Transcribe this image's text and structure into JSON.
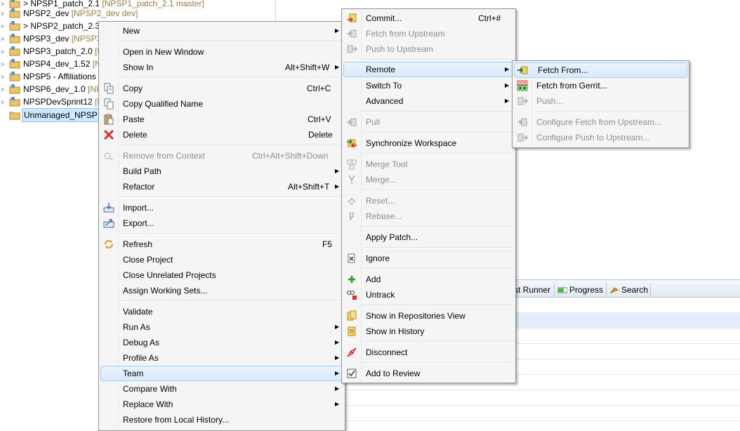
{
  "explorer": {
    "projects": [
      {
        "name": "> NPSP1_patch_2.1",
        "decoration": "[NPSP1_patch_2.1 master]",
        "twisty": "▹"
      },
      {
        "name": "NPSP2_dev",
        "decoration": "[NPSP2_dev dev]",
        "twisty": "▹"
      },
      {
        "name": "> NPSP2_patch_2.3",
        "decoration": "",
        "twisty": "▹"
      },
      {
        "name": "NPSP3_dev",
        "decoration": "[NPSP3_",
        "twisty": "▹"
      },
      {
        "name": "NPSP3_patch_2.0",
        "decoration": "[N",
        "twisty": "▹"
      },
      {
        "name": "NPSP4_dev_1.52",
        "decoration": "[NP",
        "twisty": "▹"
      },
      {
        "name": "NPSP5 - Affiliations",
        "decoration": "",
        "twisty": "▹"
      },
      {
        "name": "NPSP6_dev_1.0",
        "decoration": "[NPS",
        "twisty": "▹"
      },
      {
        "name": "NPSPDevSprint12",
        "decoration": "[N",
        "twisty": "▹"
      },
      {
        "name": "Unmanaged_NPSP [",
        "decoration": "",
        "twisty": ""
      }
    ]
  },
  "views": {
    "tabs": [
      {
        "label": "st Runner",
        "icon": "junit-icon"
      },
      {
        "label": "Progress",
        "icon": "progress-icon"
      },
      {
        "label": "Search",
        "icon": "search-icon"
      }
    ]
  },
  "context_menu": {
    "new": "New",
    "open_new_window": "Open in New Window",
    "show_in": "Show In",
    "show_in_accel": "Alt+Shift+W",
    "copy": "Copy",
    "copy_accel": "Ctrl+C",
    "copy_qualified": "Copy Qualified Name",
    "paste": "Paste",
    "paste_accel": "Ctrl+V",
    "delete": "Delete",
    "delete_accel": "Delete",
    "remove_context": "Remove from Context",
    "remove_context_accel": "Ctrl+Alt+Shift+Down",
    "build_path": "Build Path",
    "refactor": "Refactor",
    "refactor_accel": "Alt+Shift+T",
    "import": "Import...",
    "export": "Export...",
    "refresh": "Refresh",
    "refresh_accel": "F5",
    "close_project": "Close Project",
    "close_unrelated": "Close Unrelated Projects",
    "assign_sets": "Assign Working Sets...",
    "validate": "Validate",
    "run_as": "Run As",
    "debug_as": "Debug As",
    "profile_as": "Profile As",
    "team": "Team",
    "compare_with": "Compare With",
    "replace_with": "Replace With",
    "restore_history": "Restore from Local History..."
  },
  "team_menu": {
    "commit": "Commit...",
    "commit_accel": "Ctrl+#",
    "fetch_upstream": "Fetch from Upstream",
    "push_upstream": "Push to Upstream",
    "remote": "Remote",
    "switch_to": "Switch To",
    "advanced": "Advanced",
    "pull": "Pull",
    "synchronize": "Synchronize Workspace",
    "merge_tool": "Merge Tool",
    "merge": "Merge...",
    "reset": "Reset...",
    "rebase": "Rebase...",
    "apply_patch": "Apply Patch...",
    "ignore": "Ignore",
    "add": "Add",
    "untrack": "Untrack",
    "show_repos": "Show in Repositories View",
    "show_history": "Show in History",
    "disconnect": "Disconnect",
    "add_review": "Add to Review"
  },
  "remote_menu": {
    "fetch_from": "Fetch From...",
    "fetch_gerrit": "Fetch from Gerrit...",
    "push": "Push...",
    "configure_fetch": "Configure Fetch from Upstream...",
    "configure_push": "Configure Push to Upstream..."
  },
  "colors": {
    "menu_bg": "#f5f5f5",
    "hover_bg": "#d9e9fb",
    "hover_border": "#a8cef3",
    "disabled_text": "#8d8d8d",
    "decoration": "#957d47"
  }
}
